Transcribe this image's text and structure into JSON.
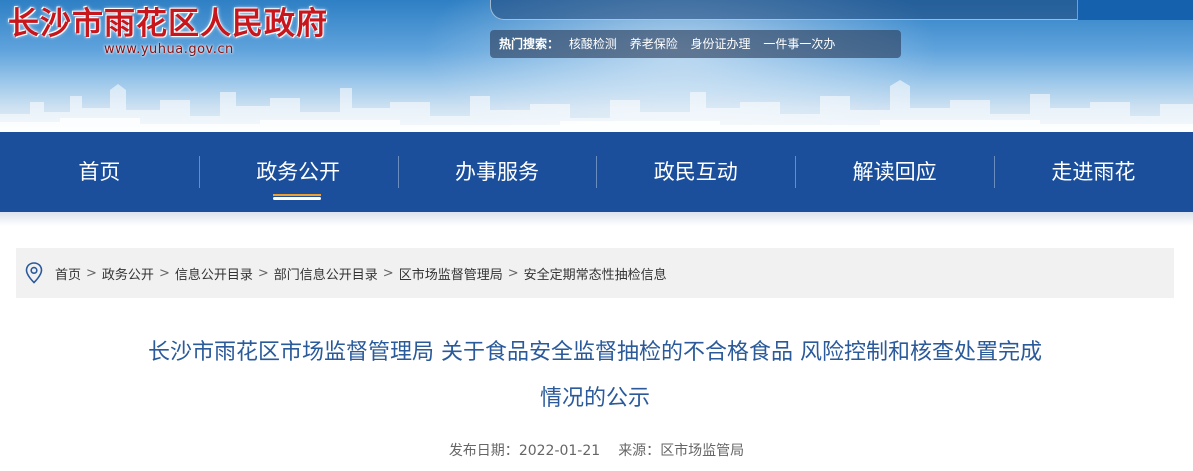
{
  "header": {
    "site_title": "长沙市雨花区人民政府",
    "site_url": "www.yuhua.gov.cn",
    "hot_search": {
      "label": "热门搜索：",
      "items": [
        "核酸检测",
        "养老保险",
        "身份证办理",
        "一件事一次办"
      ]
    }
  },
  "nav": {
    "items": [
      {
        "label": "首页",
        "active": false
      },
      {
        "label": "政务公开",
        "active": true
      },
      {
        "label": "办事服务",
        "active": false
      },
      {
        "label": "政民互动",
        "active": false
      },
      {
        "label": "解读回应",
        "active": false
      },
      {
        "label": "走进雨花",
        "active": false
      }
    ]
  },
  "breadcrumb": {
    "icon": "location-pin-icon",
    "separator": ">",
    "items": [
      "首页",
      "政务公开",
      "信息公开目录",
      "部门信息公开目录",
      "区市场监督管理局",
      "安全定期常态性抽检信息"
    ]
  },
  "article": {
    "title_line1": "长沙市雨花区市场监督管理局 关于食品安全监督抽检的不合格食品 风险控制和核查处置完成",
    "title_line2": "情况的公示",
    "publish_label": "发布日期：",
    "publish_date": "2022-01-21",
    "source_label": "来源：",
    "source": "区市场监管局"
  },
  "colors": {
    "nav_bg": "#1b4f9c",
    "title_red": "#c8161d",
    "article_title": "#2a5a9a",
    "breadcrumb_bg": "#f1f1f1"
  }
}
